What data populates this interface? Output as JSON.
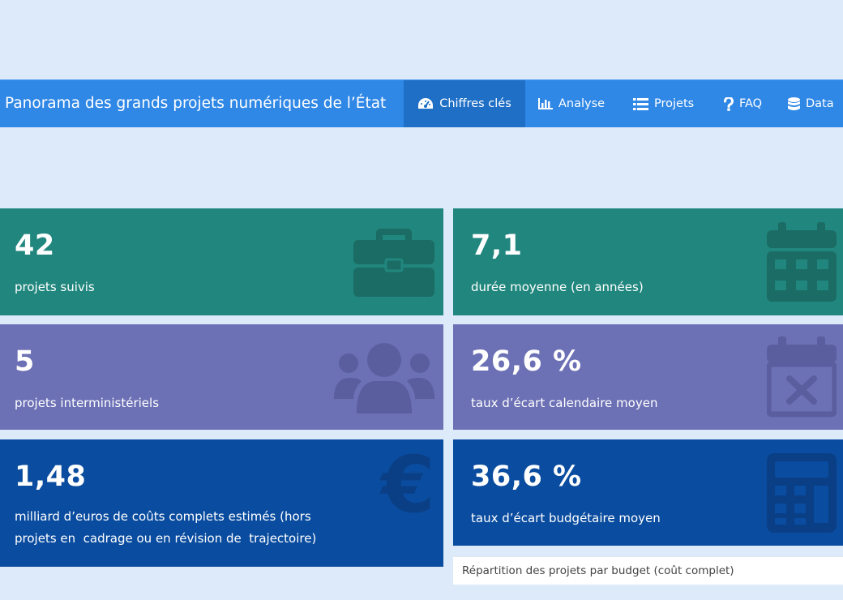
{
  "navbar": {
    "brand": "Panorama des grands projets numériques de l’État",
    "items": [
      {
        "label": "Chiffres clés",
        "icon": "dashboard-icon",
        "active": true
      },
      {
        "label": "Analyse",
        "icon": "bar-chart-icon",
        "active": false
      },
      {
        "label": "Projets",
        "icon": "list-icon",
        "active": false
      },
      {
        "label": "FAQ",
        "icon": "question-icon",
        "active": false
      },
      {
        "label": "Data",
        "icon": "database-icon",
        "active": false
      }
    ]
  },
  "tiles": [
    {
      "value": "42",
      "label": "projets suivis",
      "icon": "briefcase-icon",
      "color": "#21877e"
    },
    {
      "value": "7,1",
      "label": "durée moyenne (en années)",
      "icon": "calendar-icon",
      "color": "#21877e"
    },
    {
      "value": "5",
      "label": "projets interministériels",
      "icon": "users-icon",
      "color": "#6c70b5"
    },
    {
      "value": "26,6 %",
      "label": "taux d’écart calendaire moyen",
      "icon": "calendar-times-icon",
      "color": "#6c70b5"
    },
    {
      "value": "1,48",
      "label_line1": "milliard d’euros de coûts complets estimés (hors",
      "label_line2": "projets en  cadrage ou en révision de  trajectoire)",
      "icon": "euro-icon",
      "color": "#0a4c9f"
    },
    {
      "value": "36,6 %",
      "label": "taux d’écart budgétaire moyen",
      "icon": "calculator-icon",
      "color": "#0a4c9f"
    }
  ],
  "budget_panel": {
    "title": "Répartition des projets par budget (coût complet)"
  }
}
